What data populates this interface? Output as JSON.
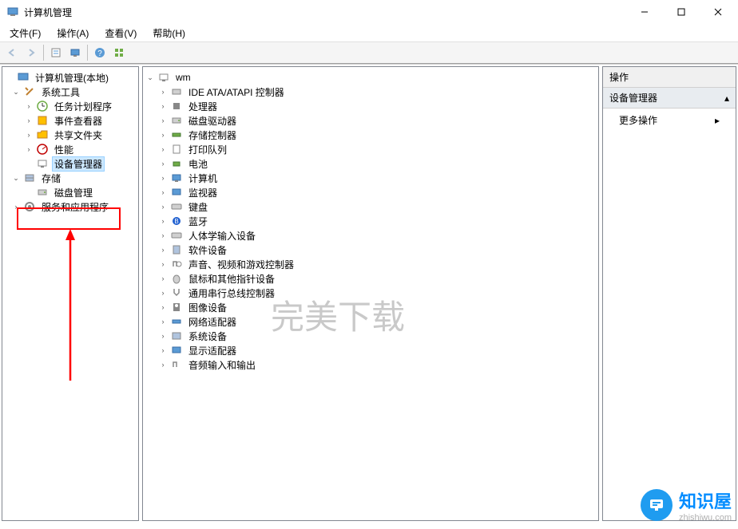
{
  "titlebar": {
    "title": "计算机管理"
  },
  "menubar": {
    "file": "文件(F)",
    "action": "操作(A)",
    "view": "查看(V)",
    "help": "帮助(H)"
  },
  "left_tree": {
    "root": "计算机管理(本地)",
    "system_tools": "系统工具",
    "task_scheduler": "任务计划程序",
    "event_viewer": "事件查看器",
    "shared_folders": "共享文件夹",
    "performance": "性能",
    "device_manager": "设备管理器",
    "storage": "存储",
    "disk_management": "磁盘管理",
    "services_apps": "服务和应用程序"
  },
  "mid_tree": {
    "root": "wm",
    "items": [
      "IDE ATA/ATAPI 控制器",
      "处理器",
      "磁盘驱动器",
      "存储控制器",
      "打印队列",
      "电池",
      "计算机",
      "监视器",
      "键盘",
      "蓝牙",
      "人体学输入设备",
      "软件设备",
      "声音、视频和游戏控制器",
      "鼠标和其他指针设备",
      "通用串行总线控制器",
      "图像设备",
      "网络适配器",
      "系统设备",
      "显示适配器",
      "音频输入和输出"
    ]
  },
  "right_pane": {
    "header": "操作",
    "sub_header": "设备管理器",
    "more_actions": "更多操作"
  },
  "watermark": "完美下载",
  "brand": {
    "cn": "知识屋",
    "url": "zhishiwu.com"
  }
}
